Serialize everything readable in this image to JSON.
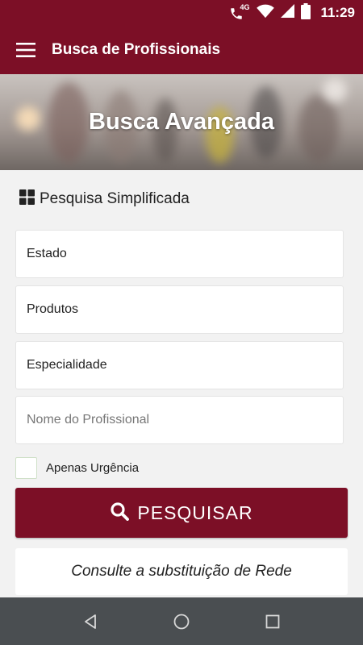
{
  "status_bar": {
    "time": "11:29",
    "network": "4G",
    "icons": [
      "phone-wifi-icon",
      "wifi-icon",
      "signal-icon",
      "battery-icon"
    ]
  },
  "app_bar": {
    "title": "Busca de Profissionais",
    "menu_icon": "hamburger-menu-icon"
  },
  "hero": {
    "title": "Busca Avançada"
  },
  "section": {
    "icon": "grid-icon",
    "title": "Pesquisa Simplificada"
  },
  "fields": [
    {
      "value": "Estado"
    },
    {
      "value": "Produtos"
    },
    {
      "value": "Especialidade"
    },
    {
      "placeholder": "Nome do Profissional"
    }
  ],
  "checkbox": {
    "label": "Apenas Urgência",
    "checked": false
  },
  "search_button": {
    "label": "PESQUISAR",
    "icon": "search-icon"
  },
  "link": {
    "label": "Consulte a substituição de Rede"
  },
  "nav_bar": {
    "icons": [
      "back-icon",
      "home-icon",
      "recents-icon"
    ]
  },
  "colors": {
    "primary": "#7c0f26",
    "background": "#f2f2f2",
    "nav_bar": "#4a4e51"
  }
}
